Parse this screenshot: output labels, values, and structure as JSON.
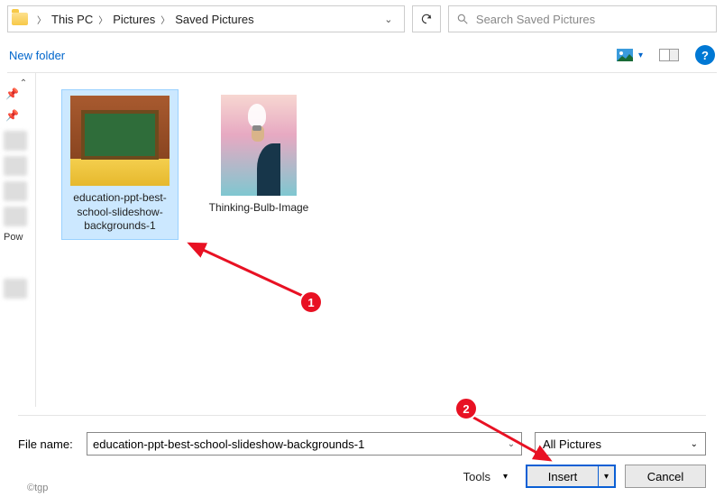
{
  "breadcrumb": [
    "This PC",
    "Pictures",
    "Saved Pictures"
  ],
  "search": {
    "placeholder": "Search Saved Pictures"
  },
  "toolbar": {
    "new_folder": "New folder"
  },
  "sidebar": {
    "label1": "Pow"
  },
  "files": [
    {
      "name": "education-ppt-best-school-slideshow-backgrounds-1",
      "selected": true
    },
    {
      "name": "Thinking-Bulb-Image",
      "selected": false
    }
  ],
  "footer": {
    "filename_label": "File name:",
    "filename_value": "education-ppt-best-school-slideshow-backgrounds-1",
    "filter": "All Pictures",
    "tools": "Tools",
    "insert": "Insert",
    "cancel": "Cancel"
  },
  "watermark": "©tgp",
  "annotations": {
    "badge1": "1",
    "badge2": "2"
  }
}
